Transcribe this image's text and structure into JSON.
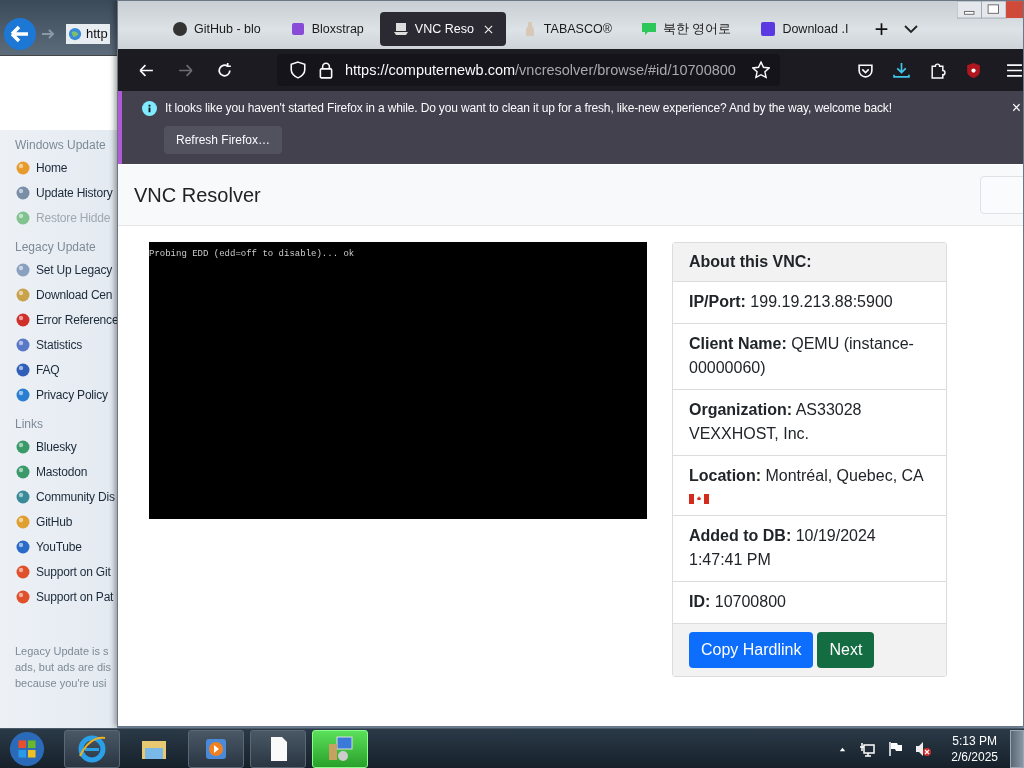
{
  "background_window": {
    "address": "http",
    "sidebar": [
      {
        "heading": "Windows Update",
        "items": [
          {
            "label": "Home",
            "disabled": false
          },
          {
            "label": "Update History",
            "disabled": false
          },
          {
            "label": "Restore Hidde",
            "disabled": true
          }
        ]
      },
      {
        "heading": "Legacy Update",
        "items": [
          {
            "label": "Set Up Legacy",
            "disabled": false
          },
          {
            "label": "Download Cen",
            "disabled": false
          },
          {
            "label": "Error Reference",
            "disabled": false
          },
          {
            "label": "Statistics",
            "disabled": false
          },
          {
            "label": "FAQ",
            "disabled": false
          },
          {
            "label": "Privacy Policy",
            "disabled": false
          }
        ]
      },
      {
        "heading": "Links",
        "items": [
          {
            "label": "Bluesky",
            "disabled": false
          },
          {
            "label": "Mastodon",
            "disabled": false
          },
          {
            "label": "Community Dis",
            "disabled": false
          },
          {
            "label": "GitHub",
            "disabled": false
          },
          {
            "label": "YouTube",
            "disabled": false
          },
          {
            "label": "Support on Git",
            "disabled": false
          },
          {
            "label": "Support on Pat",
            "disabled": false
          }
        ]
      }
    ],
    "footer": [
      "Legacy Update is s",
      "ads, but ads are dis",
      "because you're usi"
    ]
  },
  "browser": {
    "tabs": [
      {
        "label": "GitHub - blo",
        "selected": false
      },
      {
        "label": "Bloxstrap",
        "selected": false
      },
      {
        "label": "VNC Reso",
        "selected": true
      },
      {
        "label": "TABASCO®",
        "selected": false
      },
      {
        "label": "북한 영어로",
        "selected": false
      },
      {
        "label": "Download .I",
        "selected": false
      }
    ],
    "new_tab": "+",
    "url_host": "https://computernewb.com",
    "url_path": "/vncresolver/browse/#id/10700800",
    "notification": {
      "message": "It looks like you haven't started Firefox in a while. Do you want to clean it up for a fresh, like-new experience? And by the way, welcome back!",
      "button": "Refresh Firefox…",
      "close": "×"
    }
  },
  "page": {
    "title": "VNC Resolver",
    "screen_text": "Probing EDD (edd=off to disable)... ok",
    "card": {
      "heading": "About this VNC:",
      "rows": [
        {
          "label": "IP/Port:",
          "value": "199.19.213.88:5900",
          "kind": "text"
        },
        {
          "label": "Client Name:",
          "value": "QEMU (instance-00000060)",
          "kind": "text"
        },
        {
          "label": "Organization:",
          "value": "AS33028 VEXXHOST, Inc.",
          "kind": "text"
        },
        {
          "label": "Location:",
          "value": "Montréal, Quebec, CA",
          "kind": "flag"
        },
        {
          "label": "Added to DB:",
          "value": "10/19/2024 1:47:41 PM",
          "kind": "text"
        },
        {
          "label": "ID:",
          "value": "10700800",
          "kind": "text"
        }
      ],
      "buttons": [
        {
          "label": "Copy Hardlink",
          "kind": "primary"
        },
        {
          "label": "Next",
          "kind": "success"
        }
      ]
    }
  },
  "taskbar": {
    "apps": [
      {
        "selected": false
      },
      {
        "selected": false
      },
      {
        "selected": false
      },
      {
        "selected": false
      },
      {
        "selected": true
      }
    ],
    "time": "5:13 PM",
    "date": "2/6/2025"
  }
}
